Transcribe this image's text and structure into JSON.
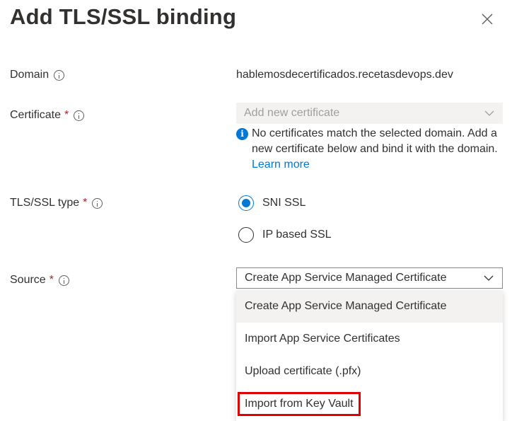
{
  "panel": {
    "title": "Add TLS/SSL binding",
    "close_icon": "close-icon"
  },
  "domain": {
    "label": "Domain",
    "value": "hablemosdecertificados.recetasdevops.dev"
  },
  "certificate": {
    "label": "Certificate",
    "required": "*",
    "placeholder": "Add new certificate",
    "info_text": "No certificates match the selected domain. Add a new certificate below and bind it with the domain.",
    "info_link": "Learn more"
  },
  "tls_type": {
    "label": "TLS/SSL type",
    "required": "*",
    "options": [
      {
        "label": "SNI SSL",
        "checked": true
      },
      {
        "label": "IP based SSL",
        "checked": false
      }
    ]
  },
  "source": {
    "label": "Source",
    "required": "*",
    "selected": "Create App Service Managed Certificate",
    "options": [
      "Create App Service Managed Certificate",
      "Import App Service Certificates",
      "Upload certificate (.pfx)",
      "Import from Key Vault"
    ],
    "highlighted_option": "Import from Key Vault",
    "highlight_color": "#e00000"
  },
  "colors": {
    "accent": "#0078d4",
    "required": "#a4262c",
    "text": "#323130",
    "disabled_bg": "#f3f2f1"
  }
}
